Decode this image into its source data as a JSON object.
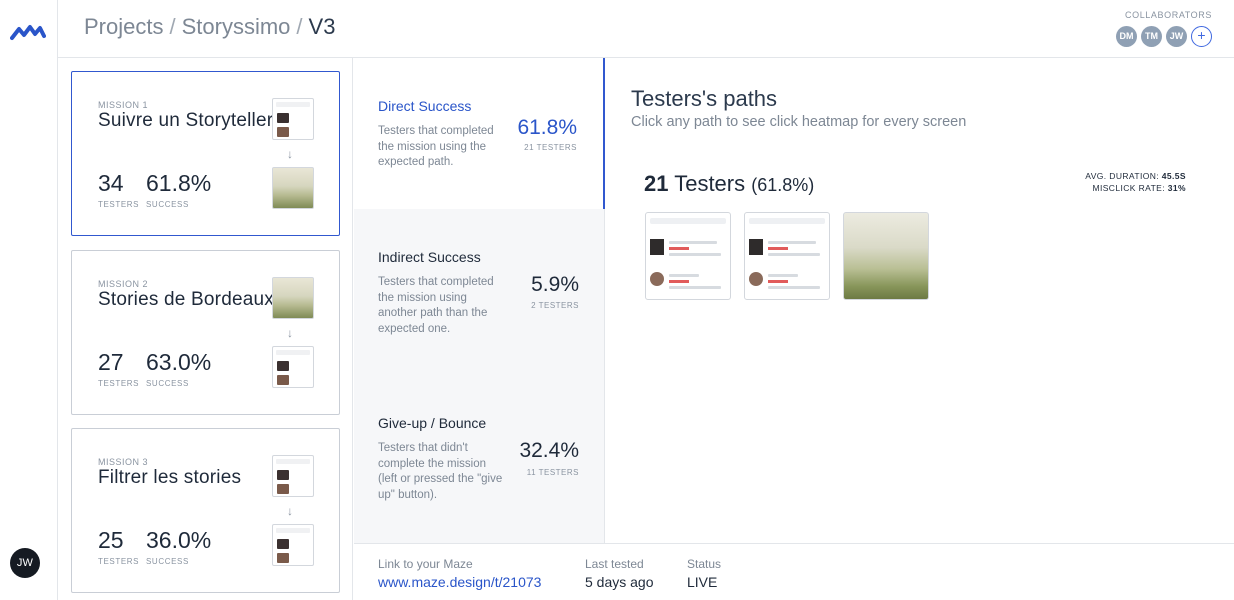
{
  "app": {
    "logo": "maze-logo-icon",
    "user_initials": "JW"
  },
  "header": {
    "breadcrumbs": [
      "Projects",
      "Storyssimo",
      "V3"
    ],
    "separator": "/",
    "collaborators_label": "COLLABORATORS",
    "collaborators": [
      "DM",
      "TM",
      "JW"
    ],
    "add_label": "+"
  },
  "missions": [
    {
      "number": "MISSION 1",
      "title": "Suivre un Storyteller",
      "testers": "34",
      "testers_label": "TESTERS",
      "success": "61.8%",
      "success_label": "SUCCESS",
      "active": true
    },
    {
      "number": "MISSION 2",
      "title": "Stories de Bordeaux",
      "testers": "27",
      "testers_label": "TESTERS",
      "success": "63.0%",
      "success_label": "SUCCESS",
      "active": false
    },
    {
      "number": "MISSION 3",
      "title": "Filtrer les stories",
      "testers": "25",
      "testers_label": "TESTERS",
      "success": "36.0%",
      "success_label": "SUCCESS",
      "active": false
    }
  ],
  "outcomes": [
    {
      "title": "Direct Success",
      "description": "Testers that completed the mission using the expected path.",
      "percent": "61.8%",
      "count": "21 TESTERS",
      "active": true
    },
    {
      "title": "Indirect Success",
      "description": "Testers that completed the mission using another path than the expected one.",
      "percent": "5.9%",
      "count": "2 TESTERS",
      "active": false
    },
    {
      "title": "Give-up / Bounce",
      "description": "Testers that didn't complete the mission (left or pressed the \"give up\" button).",
      "percent": "32.4%",
      "count": "11 TESTERS",
      "active": false
    }
  ],
  "paths": {
    "title": "Testers's paths",
    "subtitle": "Click any path to see click heatmap for every screen",
    "count_number": "21",
    "count_word": "Testers",
    "count_percent": "(61.8%)",
    "avg_duration_label": "AVG. DURATION:",
    "avg_duration_value": "45.5S",
    "misclick_label": "MISCLICK RATE:",
    "misclick_value": "31%",
    "screens": [
      {
        "title": "L'instant Parisien",
        "subtitle": "Bordeaux"
      },
      {
        "title": "L'instant Parisien",
        "subtitle": "Bordeaux"
      },
      {
        "title": "Bordeaux",
        "subtitle": ""
      }
    ]
  },
  "footer": {
    "link_label": "Link to your Maze",
    "link_value": "www.maze.design/t/21073",
    "last_tested_label": "Last tested",
    "last_tested_value": "5 days ago",
    "status_label": "Status",
    "status_value": "LIVE"
  }
}
